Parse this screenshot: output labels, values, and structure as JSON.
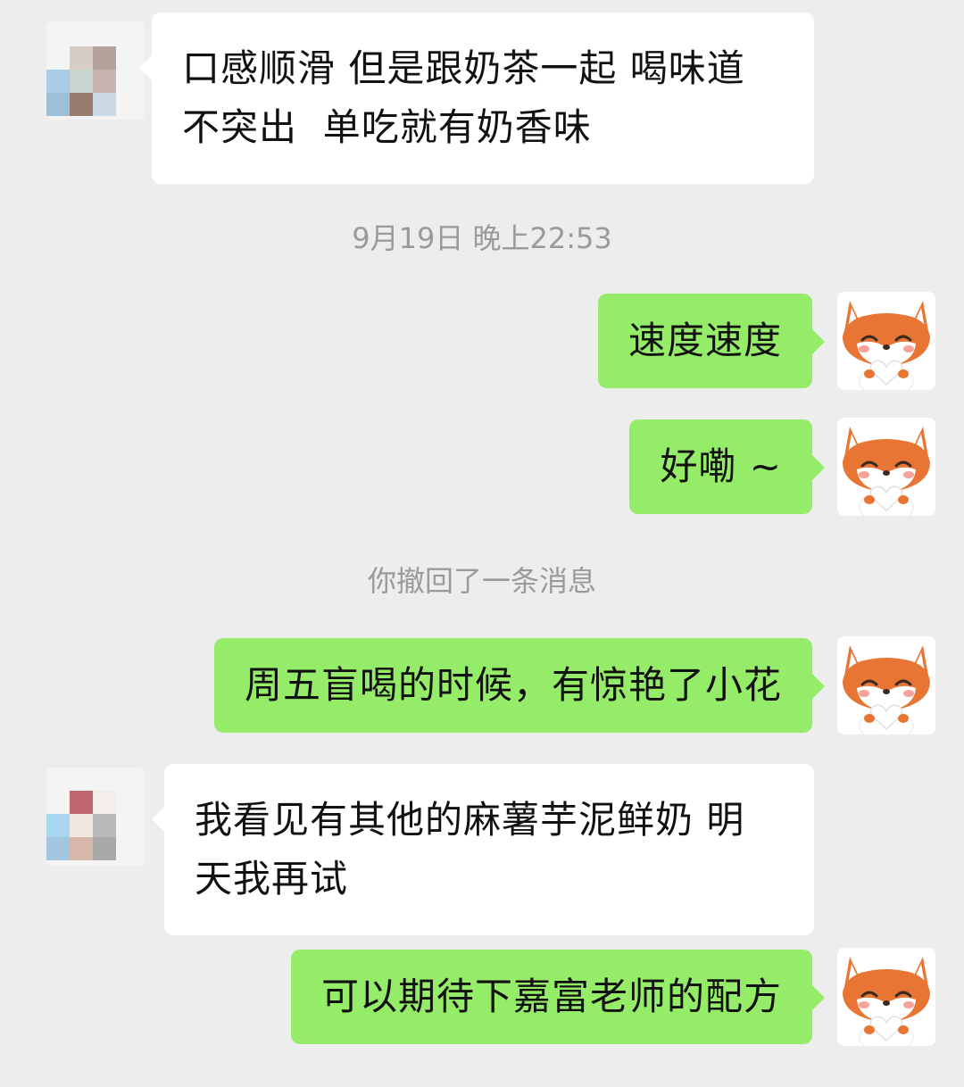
{
  "messages": {
    "m1": "口感顺滑 但是跟奶茶一起 喝味道\n不突出  单吃就有奶香味",
    "m2": "速度速度",
    "m3": "好嘞 ~",
    "m4": "周五盲喝的时候，有惊艳了小花",
    "m5": "我看见有其他的麻薯芋泥鲜奶 明\n天我再试",
    "m6": "可以期待下嘉富老师的配方"
  },
  "system": {
    "timestamp": "9月19日 晚上22:53",
    "recall_notice": "你撤回了一条消息"
  },
  "colors": {
    "background": "#ededed",
    "incoming_bubble": "#ffffff",
    "outgoing_bubble": "#95ec69",
    "system_text": "#9a9a9a"
  },
  "icons": {
    "contact_avatar": "pixelated-avatar-icon",
    "self_avatar": "fox-avatar-icon"
  }
}
